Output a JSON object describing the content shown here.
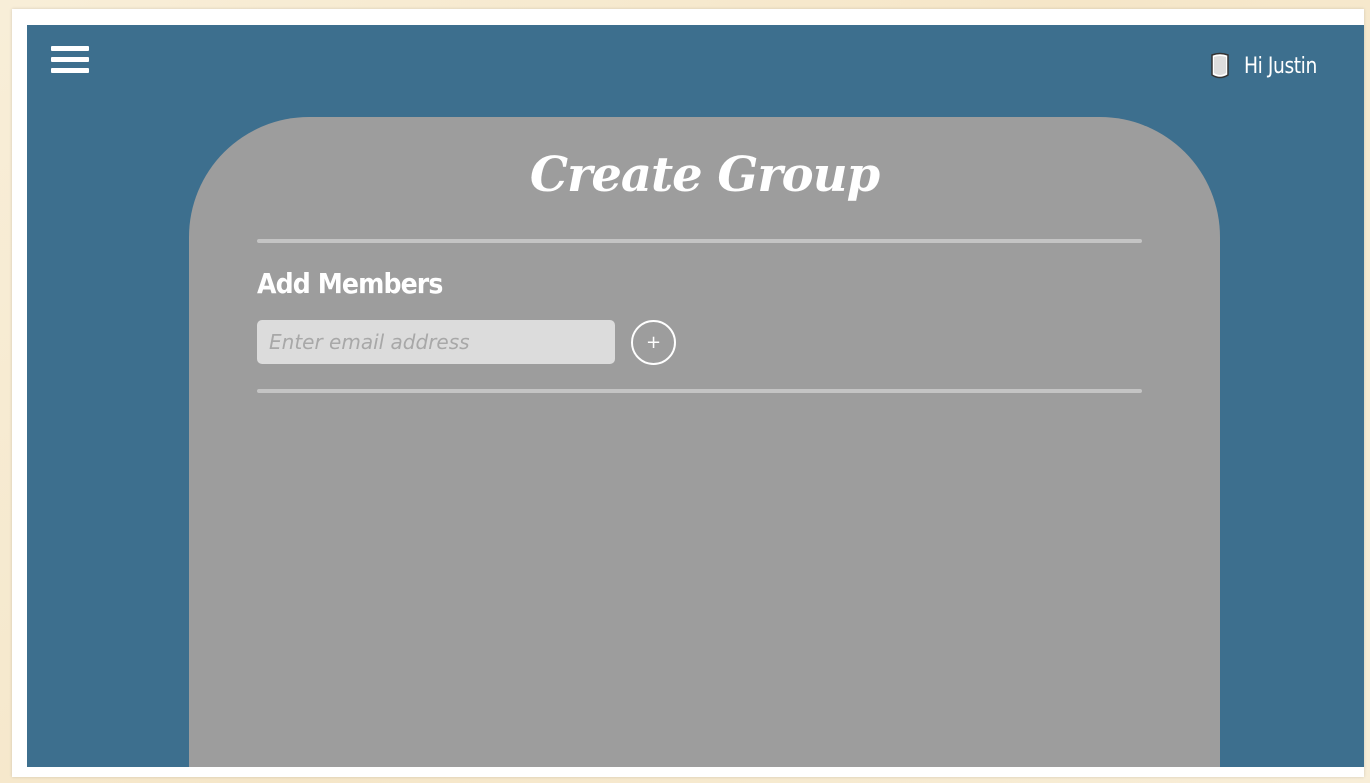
{
  "header": {
    "menu_icon": "hamburger-menu-icon",
    "avatar_icon": "user-avatar-icon",
    "greeting": "Hi Justin"
  },
  "card": {
    "title": "Create Group",
    "section_label": "Add Members",
    "email_input": {
      "value": "",
      "placeholder": "Enter email address"
    },
    "add_button": {
      "label": "+",
      "icon": "plus-circle-icon"
    }
  },
  "colors": {
    "page_background": "#3d6f8e",
    "card_background": "#9d9d9d",
    "divider": "#c4c4c4",
    "input_background": "#dcdcdc",
    "text": "#ffffff"
  }
}
